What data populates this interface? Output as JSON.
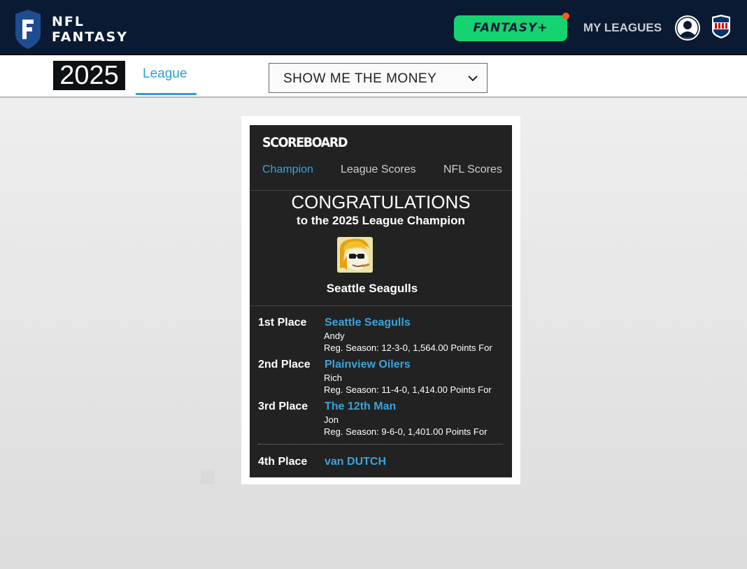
{
  "header": {
    "logo_line1": "NFL",
    "logo_line2": "FANTASY",
    "fantasy_plus_label": "FANTASY+",
    "my_leagues_label": "MY LEAGUES"
  },
  "subnav": {
    "year": "2025",
    "tab_league": "League",
    "league_select_value": "SHOW ME THE MONEY"
  },
  "scoreboard": {
    "title": "SCOREBOARD",
    "tabs": [
      "Champion",
      "League Scores",
      "NFL Scores"
    ],
    "active_tab": "Champion",
    "congrats_heading": "CONGRATULATIONS",
    "congrats_sub": "to the 2025 League Champion",
    "champion_name": "Seattle Seagulls",
    "places": [
      {
        "place": "1st Place",
        "team": "Seattle Seagulls",
        "owner": "Andy",
        "record": "Reg. Season: 12-3-0, 1,564.00 Points For"
      },
      {
        "place": "2nd Place",
        "team": "Plainview Oilers",
        "owner": "Rich",
        "record": "Reg. Season: 11-4-0, 1,414.00 Points For"
      },
      {
        "place": "3rd Place",
        "team": "The 12th Man",
        "owner": "Jon",
        "record": "Reg. Season: 9-6-0, 1,401.00 Points For"
      },
      {
        "place": "4th Place",
        "team": "van DUTCH"
      }
    ]
  },
  "colors": {
    "header_bg": "#0b1a33",
    "fantasy_plus_green": "#16d372",
    "link_blue": "#3ba3db",
    "card_bg": "#222222"
  },
  "icons": [
    "nfl-fantasy-logo-icon",
    "user-avatar-icon",
    "nfl-shield-icon",
    "chevron-down-icon"
  ]
}
